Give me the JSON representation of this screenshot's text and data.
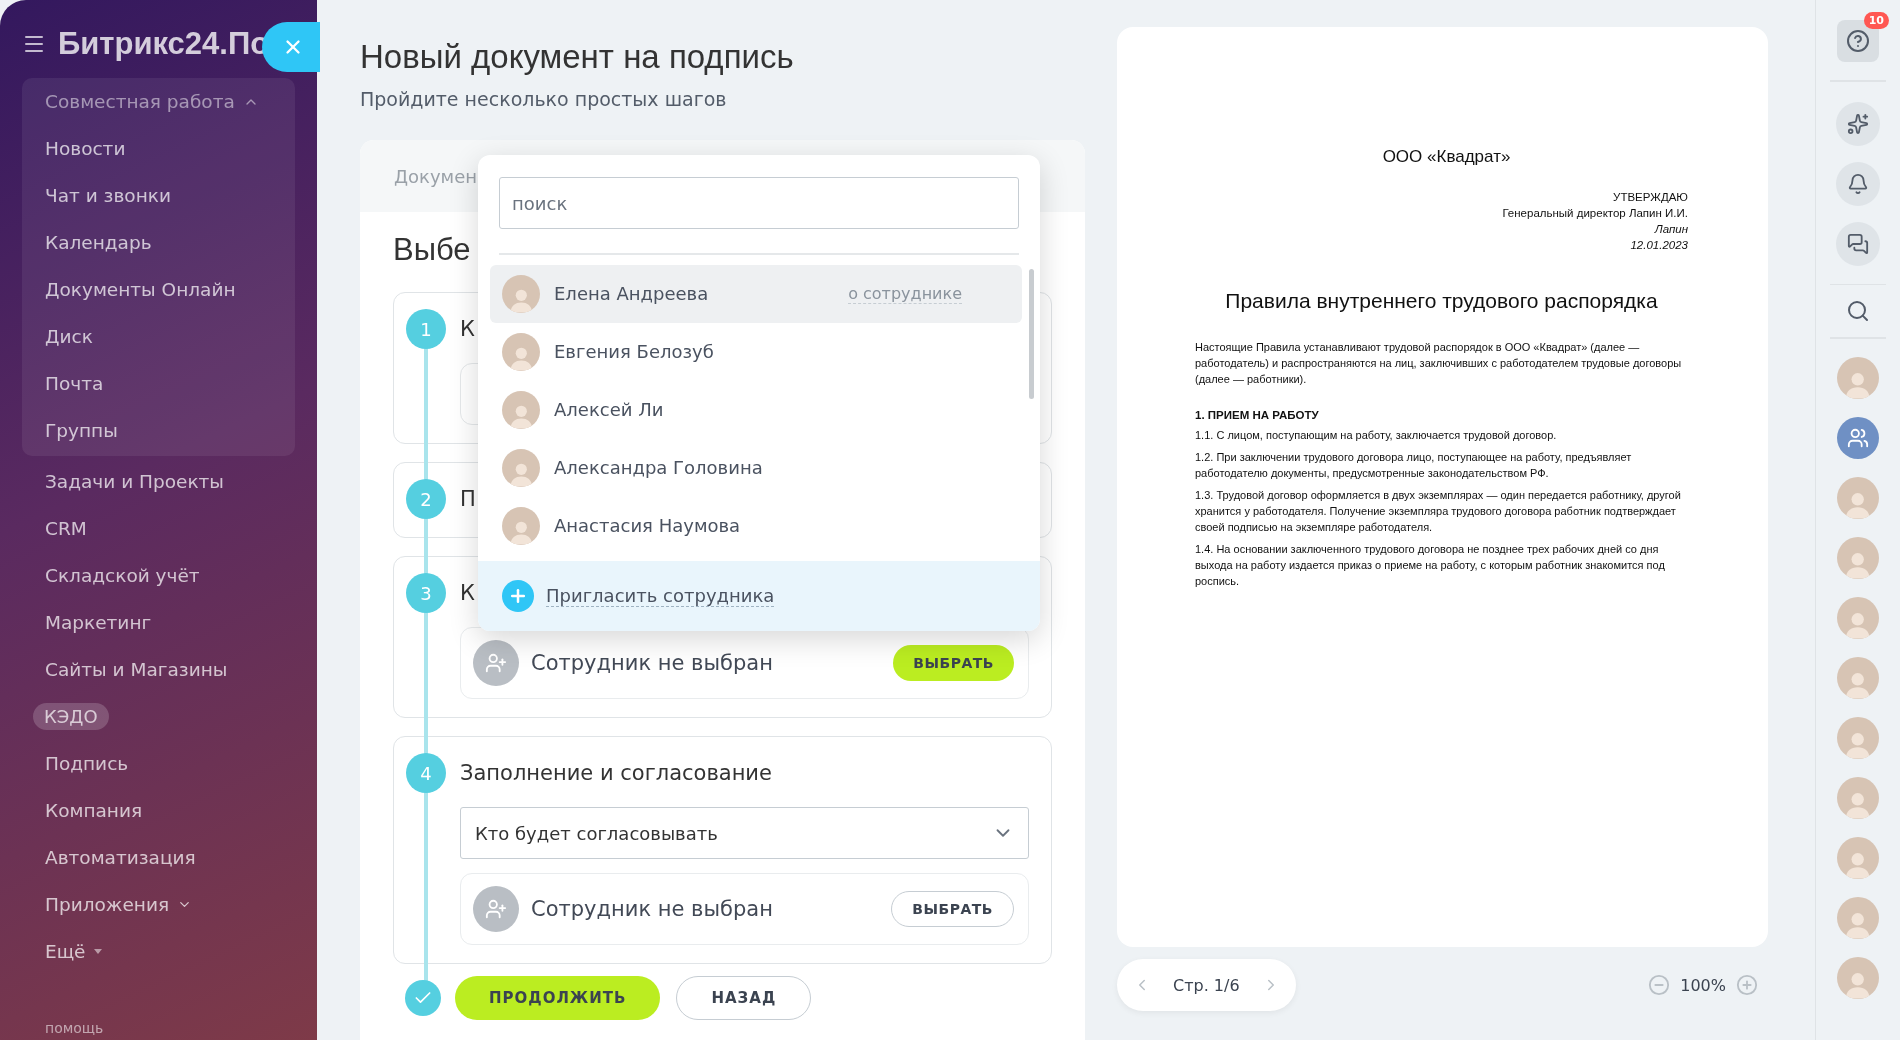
{
  "sidebar": {
    "logo": "Битрикс24.По",
    "group": {
      "label": "Совместная работа",
      "expanded": true,
      "items": [
        "Новости",
        "Чат и звонки",
        "Календарь",
        "Документы Онлайн",
        "Диск",
        "Почта",
        "Группы"
      ]
    },
    "items": [
      {
        "label": "Задачи и Проекты",
        "kind": "link"
      },
      {
        "label": "CRM",
        "kind": "link"
      },
      {
        "label": "Складской учёт",
        "kind": "link"
      },
      {
        "label": "Маркетинг",
        "kind": "link"
      },
      {
        "label": "Сайты и Магазины",
        "kind": "link"
      },
      {
        "label": "КЭДО",
        "kind": "chip"
      },
      {
        "label": "Подпись",
        "kind": "link"
      },
      {
        "label": "Компания",
        "kind": "link"
      },
      {
        "label": "Автоматизация",
        "kind": "link"
      },
      {
        "label": "Приложения",
        "kind": "expandable"
      },
      {
        "label": "Ещё",
        "kind": "more"
      }
    ],
    "help": "помощь"
  },
  "page": {
    "title": "Новый документ на подпись",
    "subtitle": "Пройдите несколько простых шагов"
  },
  "form": {
    "tab": "Докумен",
    "heading": "Выбе",
    "steps": [
      {
        "number": "1",
        "title": "К",
        "kind": "field"
      },
      {
        "number": "2",
        "title": "П",
        "kind": "plain"
      },
      {
        "number": "3",
        "title": "К",
        "kind": "employee",
        "employee": {
          "text": "Сотрудник не выбран",
          "button": "ВЫБРАТЬ",
          "primary": true
        }
      },
      {
        "number": "4",
        "title": "Заполнение и согласование",
        "kind": "select_employee",
        "select": "Кто будет согласовывать",
        "employee": {
          "text": "Сотрудник не выбран",
          "button": "ВЫБРАТЬ",
          "primary": false
        }
      }
    ],
    "actions": [
      {
        "label": "ПРОДОЛЖИТЬ",
        "primary": true
      },
      {
        "label": "НАЗАД",
        "primary": false
      }
    ]
  },
  "picker": {
    "placeholder": "поиск",
    "people": [
      {
        "name": "Елена Андреева",
        "selected": true,
        "link": "о сотруднике"
      },
      {
        "name": "Евгения Белозуб",
        "selected": false
      },
      {
        "name": "Алексей Ли",
        "selected": false
      },
      {
        "name": "Александра Головина",
        "selected": false
      },
      {
        "name": "Анастасия Наумова",
        "selected": false
      }
    ],
    "invite": "Пригласить сотрудника"
  },
  "document": {
    "company": "ООО «Квадрат»",
    "approval": [
      {
        "text": "УТВЕРЖДАЮ",
        "italic": false
      },
      {
        "text": "Генеральный директор Лапин И.И.",
        "italic": false
      },
      {
        "text": "Лапин",
        "italic": true
      },
      {
        "text": "12.01.2023",
        "italic": true
      }
    ],
    "title": "Правила внутреннего трудового распорядка",
    "intro": "Настоящие Правила устанавливают трудовой распорядок в ООО «Квадрат» (далее — работодатель) и распространяются на лиц, заключивших с работодателем трудовые договоры (далее — работники).",
    "section": "1. ПРИЕМ НА РАБОТУ",
    "paragraphs": [
      "1.1. С лицом, поступающим на работу, заключается трудовой договор.",
      "1.2. При заключении трудового договора лицо, поступающее на работу, предъявляет работодателю документы, предусмотренные законодательством РФ.",
      "1.3. Трудовой договор оформляется в двух экземплярах — один передается работнику, другой хранится у работодателя. Получение экземпляра трудового договора работник подтверждает своей подписью на экземпляре работодателя.",
      "1.4. На основании заключенного трудового договора не позднее трех рабочих дней со дня выхода на работу издается приказ о приеме на работу, с которым работник знакомится под роспись."
    ]
  },
  "pager": {
    "page": "Стр. 1/6",
    "zoom": "100%"
  },
  "right_bar": {
    "badge": "10",
    "avatars": [
      {
        "kind": "person"
      },
      {
        "kind": "group"
      },
      {
        "kind": "person"
      },
      {
        "kind": "person"
      },
      {
        "kind": "person"
      },
      {
        "kind": "person"
      },
      {
        "kind": "person"
      },
      {
        "kind": "person"
      },
      {
        "kind": "person"
      },
      {
        "kind": "person"
      },
      {
        "kind": "person"
      }
    ]
  }
}
